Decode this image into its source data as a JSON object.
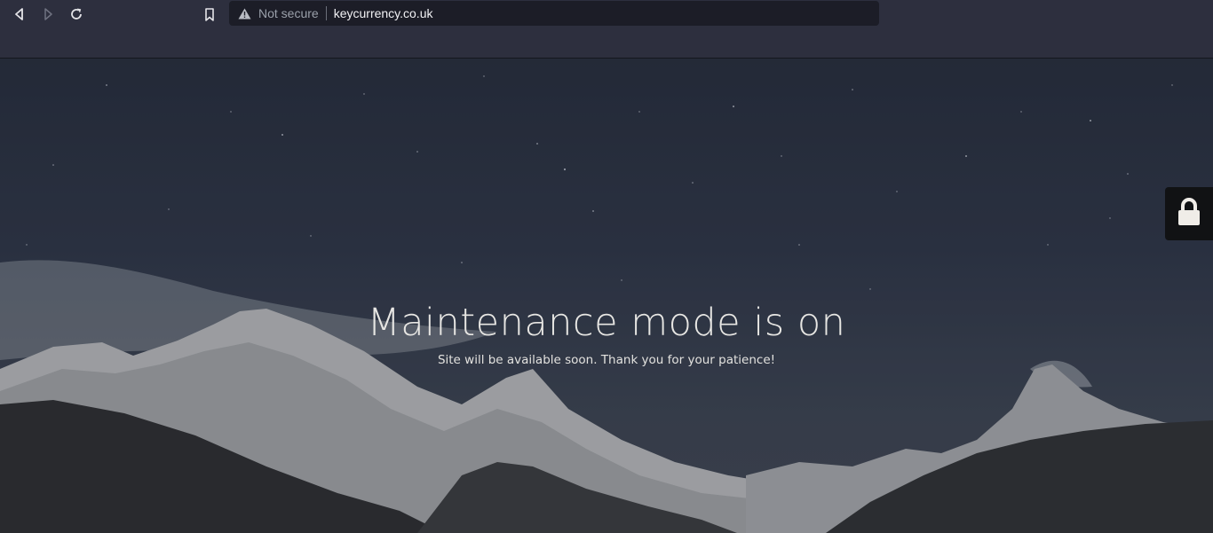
{
  "browser": {
    "security_label": "Not secure",
    "url": "keycurrency.co.uk"
  },
  "page": {
    "headline": "Maintenance mode is on",
    "subline": "Site will be available soon. Thank you for your patience!"
  },
  "icons": {
    "back": "back-arrow-icon",
    "forward": "forward-arrow-icon",
    "reload": "reload-icon",
    "bookmark": "bookmark-icon",
    "warning": "warning-triangle-icon",
    "lock": "lock-icon"
  },
  "colors": {
    "toolbar": "#2d2f3e",
    "address_bar": "#1c1d27",
    "lock_button": "#111214",
    "headline": "#e7e6e3"
  }
}
